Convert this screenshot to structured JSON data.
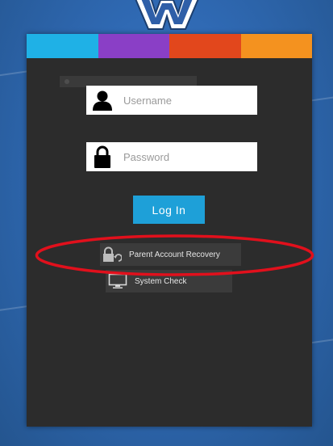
{
  "colors": {
    "bar": [
      "#1fb1e6",
      "#8a3fc6",
      "#e2471c",
      "#f4921f"
    ],
    "panel": "#2c2c2c",
    "login_button": "#1ea0d8",
    "highlight": "#e1101c"
  },
  "login": {
    "username": {
      "icon": "user-icon",
      "placeholder": "Username",
      "value": ""
    },
    "password": {
      "icon": "lock-icon",
      "placeholder": "Password",
      "value": ""
    },
    "login_label": "Log In"
  },
  "links": {
    "recovery": {
      "icon": "lock-refresh-icon",
      "label": "Parent Account Recovery"
    },
    "system_check": {
      "icon": "monitor-icon",
      "label": "System Check"
    }
  }
}
